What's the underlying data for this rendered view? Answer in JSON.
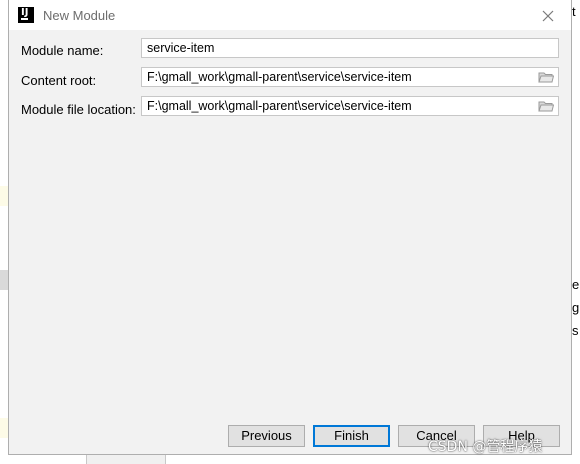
{
  "window": {
    "title": "New Module",
    "app_icon_glyph": "IJ"
  },
  "form": {
    "module_name": {
      "label": "Module name:",
      "value": "service-item"
    },
    "content_root": {
      "label": "Content root:",
      "value": "F:\\gmall_work\\gmall-parent\\service\\service-item"
    },
    "module_file_location": {
      "label": "Module file location:",
      "value": "F:\\gmall_work\\gmall-parent\\service\\service-item"
    }
  },
  "buttons": {
    "previous": "Previous",
    "finish": "Finish",
    "cancel": "Cancel",
    "help": "Help"
  },
  "background_text": {
    "t": "t",
    "e": "e",
    "g": "g",
    "s": "s"
  },
  "watermark": "CSDN @管程序猿",
  "colors": {
    "dialog_bg": "#f2f2f2",
    "primary_border": "#0078d7",
    "button_bg": "#e1e1e1"
  }
}
